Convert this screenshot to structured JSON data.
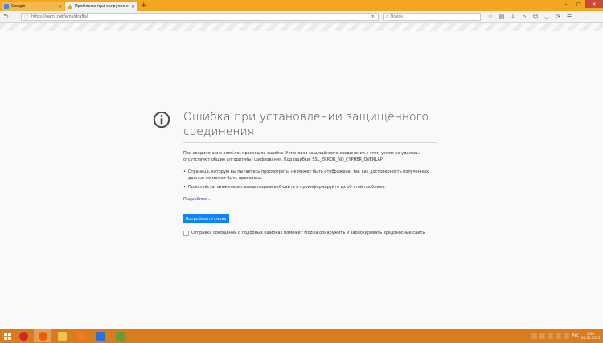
{
  "tabs": [
    {
      "label": "Google",
      "active": false,
      "favicon_color": "#4285f4"
    },
    {
      "label": "Проблема при загрузке ст",
      "active": true,
      "favicon_color": "#f0a020"
    }
  ],
  "new_tab_label": "+",
  "window_controls": {
    "minimize": "–",
    "maximize": "□",
    "close": "✕"
  },
  "navbar": {
    "url": "https://oami.net/ams/drafts/",
    "search_placeholder": "Поиск"
  },
  "error": {
    "title": "Ошибка при установлении защищённого соединения",
    "description": "При соединении с oami.net произошла ошибка. Установка защищённого соединения с этим узлом не удалась: отсутствуют общие алгоритм(ы) шифрования. Код ошибки: SSL_ERROR_NO_CYPHER_OVERLAP",
    "bullets": [
      "Страница, которую вы пытаетесь просмотреть, не может быть отображена, так как достоверность полученных данных не может быть проверена.",
      "Пожалуйста, свяжитесь с владельцами веб-сайта и проинформируйте их об этой проблеме."
    ],
    "learn_more": "Подробнее…",
    "retry_button": "Попробовать снова",
    "report_text": "Отправка сообщений о подобных ошибках поможет Mozilla обнаружить и заблокировать вредоносные сайты"
  },
  "taskbar": {
    "apps": [
      {
        "name": "opera",
        "color": "#d0262b"
      },
      {
        "name": "firefox",
        "color": "#e66000"
      },
      {
        "name": "explorer",
        "color": "#f2c24f"
      },
      {
        "name": "app-orange",
        "color": "#ef7f1a"
      },
      {
        "name": "mail",
        "color": "#2a6fd6"
      },
      {
        "name": "image-viewer",
        "color": "#6a9a3a"
      }
    ],
    "lang": "РУС",
    "time": "0:09",
    "date": "20.05.2015"
  },
  "colors": {
    "accent_button": "#0a84ff",
    "taskbar": "#d97c1f",
    "tabstrip": "#f4a622"
  }
}
